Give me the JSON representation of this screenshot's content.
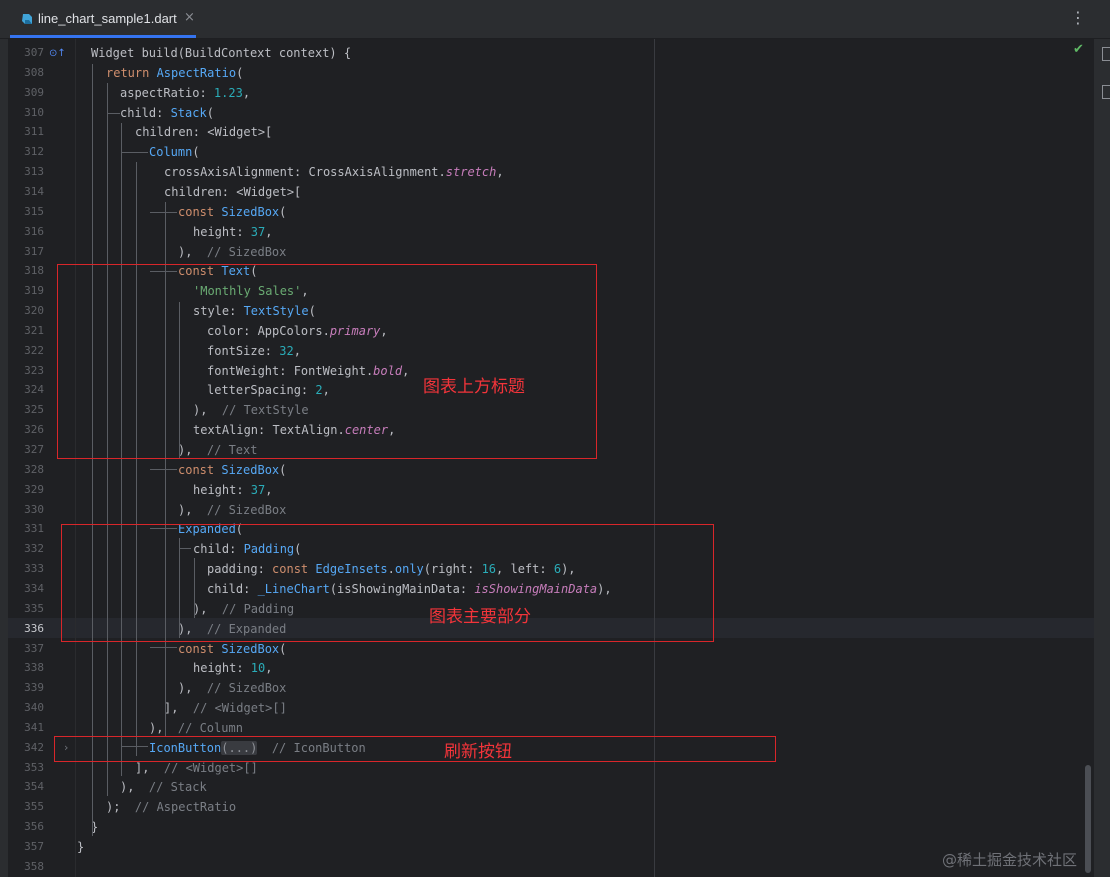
{
  "tab": {
    "filename": "line_chart_sample1.dart",
    "close_glyph": "×",
    "more_glyph": "⋮"
  },
  "status": {
    "check_glyph": "✔"
  },
  "gutter_icon_glyph": "⊙↑",
  "fold_glyph": "›",
  "code_lines": [
    {
      "no": "307",
      "tokens": [
        {
          "t": "Widget build(BuildContext context) {"
        }
      ]
    },
    {
      "no": "308",
      "tokens": [
        {
          "t": "return ",
          "c": "kw"
        },
        {
          "t": "AspectRatio",
          "c": "cls"
        },
        {
          "t": "("
        }
      ]
    },
    {
      "no": "309",
      "tokens": [
        {
          "t": "aspectRatio: "
        },
        {
          "t": "1.23",
          "c": "num"
        },
        {
          "t": ","
        }
      ]
    },
    {
      "no": "310",
      "tokens": [
        {
          "t": "child: "
        },
        {
          "t": "Stack",
          "c": "cls"
        },
        {
          "t": "("
        }
      ]
    },
    {
      "no": "311",
      "tokens": [
        {
          "t": "children: <Widget>["
        }
      ]
    },
    {
      "no": "312",
      "tokens": [
        {
          "t": "Column",
          "c": "cls"
        },
        {
          "t": "("
        }
      ]
    },
    {
      "no": "313",
      "tokens": [
        {
          "t": "crossAxisAlignment: CrossAxisAlignment."
        },
        {
          "t": "stretch",
          "c": "prop"
        },
        {
          "t": ","
        }
      ]
    },
    {
      "no": "314",
      "tokens": [
        {
          "t": "children: <Widget>["
        }
      ]
    },
    {
      "no": "315",
      "tokens": [
        {
          "t": "const ",
          "c": "kw"
        },
        {
          "t": "SizedBox",
          "c": "cls"
        },
        {
          "t": "("
        }
      ]
    },
    {
      "no": "316",
      "tokens": [
        {
          "t": "height: "
        },
        {
          "t": "37",
          "c": "num"
        },
        {
          "t": ","
        }
      ]
    },
    {
      "no": "317",
      "tokens": [
        {
          "t": "),  "
        },
        {
          "t": "// SizedBox",
          "c": "cm"
        }
      ]
    },
    {
      "no": "318",
      "tokens": [
        {
          "t": "const ",
          "c": "kw"
        },
        {
          "t": "Text",
          "c": "cls"
        },
        {
          "t": "("
        }
      ]
    },
    {
      "no": "319",
      "tokens": [
        {
          "t": "'Monthly Sales'",
          "c": "str"
        },
        {
          "t": ","
        }
      ]
    },
    {
      "no": "320",
      "tokens": [
        {
          "t": "style: "
        },
        {
          "t": "TextStyle",
          "c": "cls"
        },
        {
          "t": "("
        }
      ]
    },
    {
      "no": "321",
      "tokens": [
        {
          "t": "color: AppColors."
        },
        {
          "t": "primary",
          "c": "prop"
        },
        {
          "t": ","
        }
      ]
    },
    {
      "no": "322",
      "tokens": [
        {
          "t": "fontSize: "
        },
        {
          "t": "32",
          "c": "num"
        },
        {
          "t": ","
        }
      ]
    },
    {
      "no": "323",
      "tokens": [
        {
          "t": "fontWeight: FontWeight."
        },
        {
          "t": "bold",
          "c": "prop"
        },
        {
          "t": ","
        }
      ]
    },
    {
      "no": "324",
      "tokens": [
        {
          "t": "letterSpacing: "
        },
        {
          "t": "2",
          "c": "num"
        },
        {
          "t": ","
        }
      ]
    },
    {
      "no": "325",
      "tokens": [
        {
          "t": "),  "
        },
        {
          "t": "// TextStyle",
          "c": "cm"
        }
      ]
    },
    {
      "no": "326",
      "tokens": [
        {
          "t": "textAlign: TextAlign."
        },
        {
          "t": "center",
          "c": "prop"
        },
        {
          "t": ","
        }
      ]
    },
    {
      "no": "327",
      "tokens": [
        {
          "t": "),  "
        },
        {
          "t": "// Text",
          "c": "cm"
        }
      ]
    },
    {
      "no": "328",
      "tokens": [
        {
          "t": "const ",
          "c": "kw"
        },
        {
          "t": "SizedBox",
          "c": "cls"
        },
        {
          "t": "("
        }
      ]
    },
    {
      "no": "329",
      "tokens": [
        {
          "t": "height: "
        },
        {
          "t": "37",
          "c": "num"
        },
        {
          "t": ","
        }
      ]
    },
    {
      "no": "330",
      "tokens": [
        {
          "t": "),  "
        },
        {
          "t": "// SizedBox",
          "c": "cm"
        }
      ]
    },
    {
      "no": "331",
      "tokens": [
        {
          "t": "Expanded",
          "c": "cls"
        },
        {
          "t": "("
        }
      ]
    },
    {
      "no": "332",
      "tokens": [
        {
          "t": "child: "
        },
        {
          "t": "Padding",
          "c": "cls"
        },
        {
          "t": "("
        }
      ]
    },
    {
      "no": "333",
      "tokens": [
        {
          "t": "padding: "
        },
        {
          "t": "const ",
          "c": "kw"
        },
        {
          "t": "EdgeInsets",
          "c": "cls"
        },
        {
          "t": "."
        },
        {
          "t": "only",
          "c": "cls"
        },
        {
          "t": "(right: "
        },
        {
          "t": "16",
          "c": "num"
        },
        {
          "t": ", left: "
        },
        {
          "t": "6",
          "c": "num"
        },
        {
          "t": "),"
        }
      ]
    },
    {
      "no": "334",
      "tokens": [
        {
          "t": "child: "
        },
        {
          "t": "_LineChart",
          "c": "cls"
        },
        {
          "t": "(isShowingMainData: "
        },
        {
          "t": "isShowingMainData",
          "c": "prop"
        },
        {
          "t": "),"
        }
      ]
    },
    {
      "no": "335",
      "tokens": [
        {
          "t": "),  "
        },
        {
          "t": "// Padding",
          "c": "cm"
        }
      ]
    },
    {
      "no": "336",
      "tokens": [
        {
          "t": "),  "
        },
        {
          "t": "// Expanded",
          "c": "cm"
        }
      ]
    },
    {
      "no": "337",
      "tokens": [
        {
          "t": "const ",
          "c": "kw"
        },
        {
          "t": "SizedBox",
          "c": "cls"
        },
        {
          "t": "("
        }
      ]
    },
    {
      "no": "338",
      "tokens": [
        {
          "t": "height: "
        },
        {
          "t": "10",
          "c": "num"
        },
        {
          "t": ","
        }
      ]
    },
    {
      "no": "339",
      "tokens": [
        {
          "t": "),  "
        },
        {
          "t": "// SizedBox",
          "c": "cm"
        }
      ]
    },
    {
      "no": "340",
      "tokens": [
        {
          "t": "],  "
        },
        {
          "t": "// <Widget>[]",
          "c": "cm"
        }
      ]
    },
    {
      "no": "341",
      "tokens": [
        {
          "t": "),  "
        },
        {
          "t": "// Column",
          "c": "cm"
        }
      ]
    },
    {
      "no": "342",
      "tokens": [
        {
          "t": "IconButton",
          "c": "cls"
        },
        {
          "t": "(...)",
          "c": "fold"
        },
        {
          "t": "  "
        },
        {
          "t": "// IconButton",
          "c": "cm"
        }
      ]
    },
    {
      "no": "353",
      "tokens": [
        {
          "t": "],  "
        },
        {
          "t": "// <Widget>[]",
          "c": "cm"
        }
      ]
    },
    {
      "no": "354",
      "tokens": [
        {
          "t": "),  "
        },
        {
          "t": "// Stack",
          "c": "cm"
        }
      ]
    },
    {
      "no": "355",
      "tokens": [
        {
          "t": ");  "
        },
        {
          "t": "// AspectRatio",
          "c": "cm"
        }
      ]
    },
    {
      "no": "356",
      "tokens": [
        {
          "t": "}"
        }
      ]
    },
    {
      "no": "357",
      "tokens": [
        {
          "t": "}"
        }
      ]
    },
    {
      "no": "358",
      "tokens": []
    }
  ],
  "annotations": {
    "title_note": "图表上方标题",
    "main_note": "图表主要部分",
    "refresh_note": "刷新按钮"
  },
  "watermark": "@稀土掘金技术社区"
}
